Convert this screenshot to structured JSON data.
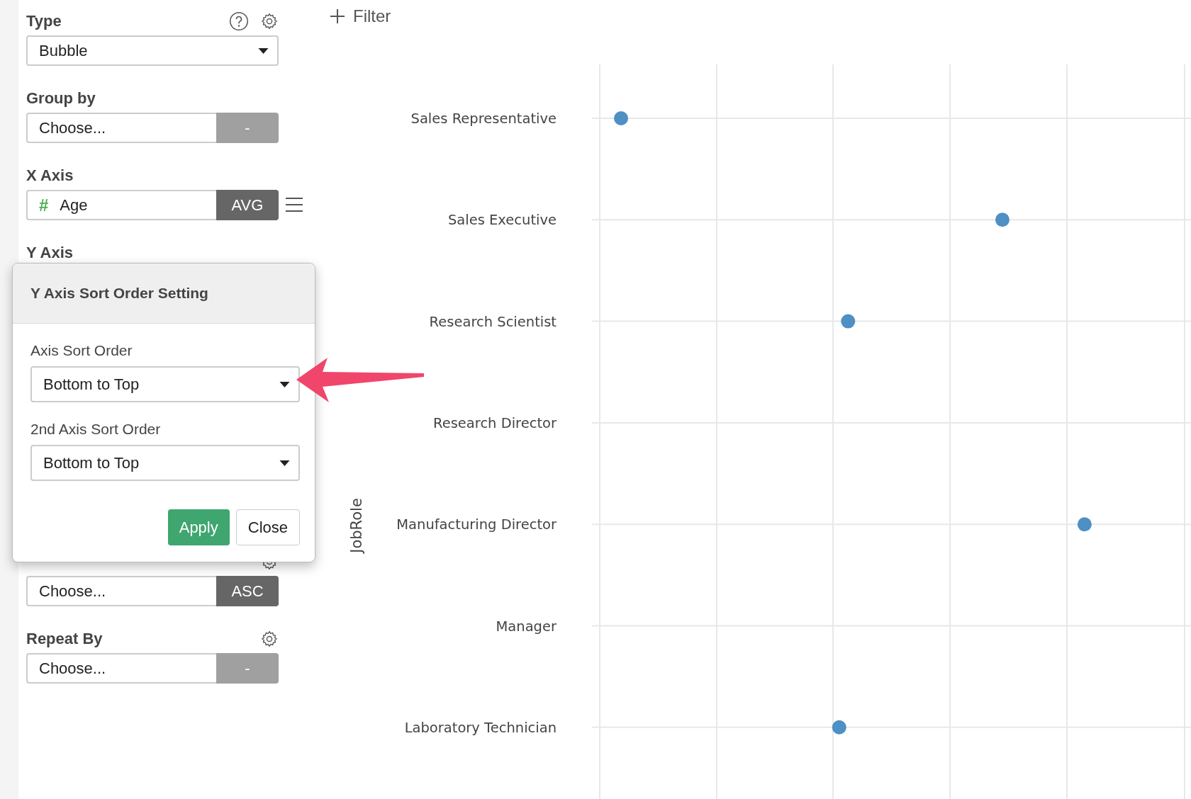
{
  "sidebar": {
    "sections": [
      {
        "kind": "select",
        "label": "Type",
        "help_icon": true,
        "gear_icon": true,
        "value": "Bubble"
      },
      {
        "kind": "pair",
        "label": "Group by",
        "value": "Choose...",
        "button": "-",
        "button_active": false
      },
      {
        "kind": "pair",
        "label": "X Axis",
        "value": "Age",
        "value_icon": "#",
        "button": "AVG",
        "button_active": true,
        "menu_icon": true
      },
      {
        "kind": "hidden",
        "label": "Y Axis"
      },
      {
        "kind": "pair",
        "value": "Choose...",
        "button": "ASC",
        "button_active": true,
        "gear_icon": true
      },
      {
        "kind": "pair",
        "label": "Repeat By",
        "value": "Choose...",
        "button": "-",
        "button_active": false,
        "gear_icon": true
      }
    ]
  },
  "popup": {
    "title": "Y Axis Sort Order Setting",
    "fields": [
      {
        "label": "Axis Sort Order",
        "value": "Bottom to Top"
      },
      {
        "label": "2nd Axis Sort Order",
        "value": "Bottom to Top"
      }
    ],
    "buttons": [
      {
        "label": "Apply",
        "kind": "primary"
      },
      {
        "label": "Close",
        "kind": "default"
      }
    ]
  },
  "filter": {
    "label": "Filter"
  },
  "chart": {
    "axis_title": "JobRole",
    "row_labels": [
      "Sales Representative",
      "Sales Executive",
      "Research Scientist",
      "Research Director",
      "Manufacturing Director",
      "Manager",
      "Laboratory Technician"
    ]
  }
}
